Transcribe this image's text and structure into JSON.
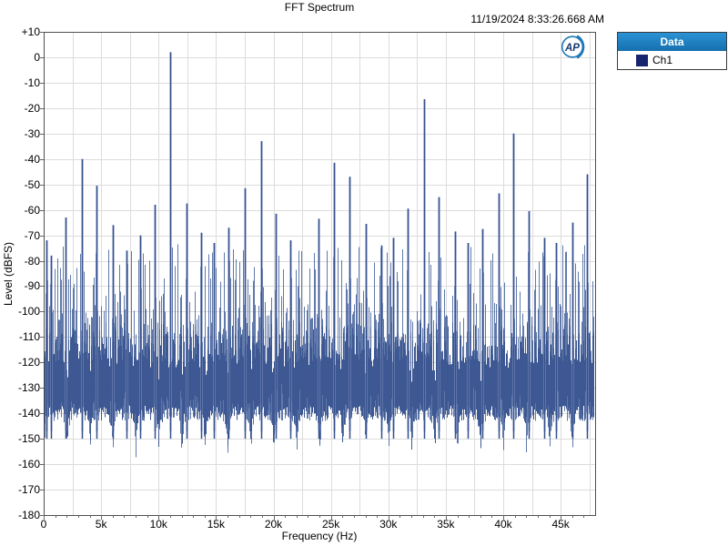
{
  "header": {
    "timestamp": "11/19/2024 8:33:26.668 AM"
  },
  "logo": {
    "text": "AP",
    "ring_color": "#1c78b8",
    "text_color": "#16386e"
  },
  "legend": {
    "header": "Data",
    "header_color_top": "#2a93d5",
    "header_color_bottom": "#176fae",
    "items": [
      {
        "label": "Ch1",
        "color": "#17256f"
      }
    ]
  },
  "chart_data": {
    "type": "line",
    "title": "FFT Spectrum",
    "xlabel": "Frequency (Hz)",
    "ylabel": "Level (dBFS)",
    "xlim": [
      0,
      48000
    ],
    "ylim": [
      -180,
      10
    ],
    "x_tick_step_hz": 5000,
    "x_minor_tick_step_hz": 1000,
    "x_tick_labels": [
      "0",
      "5k",
      "10k",
      "15k",
      "20k",
      "25k",
      "30k",
      "35k",
      "40k",
      "45k"
    ],
    "y_tick_step_db": 10,
    "y_tick_labels": [
      "+10",
      "0",
      "-10",
      "-20",
      "-30",
      "-40",
      "-50",
      "-60",
      "-70",
      "-80",
      "-90",
      "-100",
      "-110",
      "-120",
      "-130",
      "-140",
      "-150",
      "-160",
      "-170",
      "-180"
    ],
    "grid": {
      "x_step_hz": 2500,
      "y_step_db": 10,
      "on": true
    },
    "legend_position": "top-right-outside",
    "colors": {
      "grid": "#dcdcdc",
      "frame": "#4f4f4f",
      "tick": "#666666"
    },
    "series": [
      {
        "name": "Ch1",
        "color": "#44619b",
        "color_dark": "#35508c",
        "halo_color": "#aab9dd",
        "peaks_format": "[frequency_hz, level_dbfs]",
        "peaks": [
          [
            200,
            -72
          ],
          [
            600,
            -78
          ],
          [
            1900,
            -63
          ],
          [
            3300,
            -40
          ],
          [
            4600,
            -50.5
          ],
          [
            6000,
            -66
          ],
          [
            7200,
            -76
          ],
          [
            8400,
            -70
          ],
          [
            9700,
            -58
          ],
          [
            11000,
            2
          ],
          [
            12400,
            -57.5
          ],
          [
            13700,
            -69
          ],
          [
            14800,
            -73
          ],
          [
            16100,
            -67
          ],
          [
            17500,
            -51.5
          ],
          [
            18900,
            -33
          ],
          [
            20200,
            -61.5
          ],
          [
            21500,
            -72
          ],
          [
            23900,
            -63.5
          ],
          [
            25300,
            -41.5
          ],
          [
            26600,
            -47
          ],
          [
            28000,
            -65.5
          ],
          [
            29400,
            -74
          ],
          [
            30400,
            -71
          ],
          [
            31700,
            -59.5
          ],
          [
            33100,
            -16.5
          ],
          [
            34400,
            -55
          ],
          [
            35800,
            -68.5
          ],
          [
            36900,
            -73
          ],
          [
            38200,
            -67.5
          ],
          [
            39600,
            -53.5
          ],
          [
            40900,
            -30
          ],
          [
            42200,
            -60.5
          ],
          [
            43600,
            -71
          ],
          [
            44600,
            -73
          ],
          [
            46000,
            -65
          ],
          [
            47300,
            -46
          ]
        ],
        "noise_floor": {
          "description": "dense random noise band",
          "top_db_range": [
            -122,
            -96
          ],
          "spike_db_range": [
            -94,
            -73
          ],
          "spike_probability": 0.25,
          "bottom_db_range": [
            -143,
            -137
          ],
          "dip_extra_db": 15,
          "dip_period_hz": 2000
        }
      }
    ]
  }
}
